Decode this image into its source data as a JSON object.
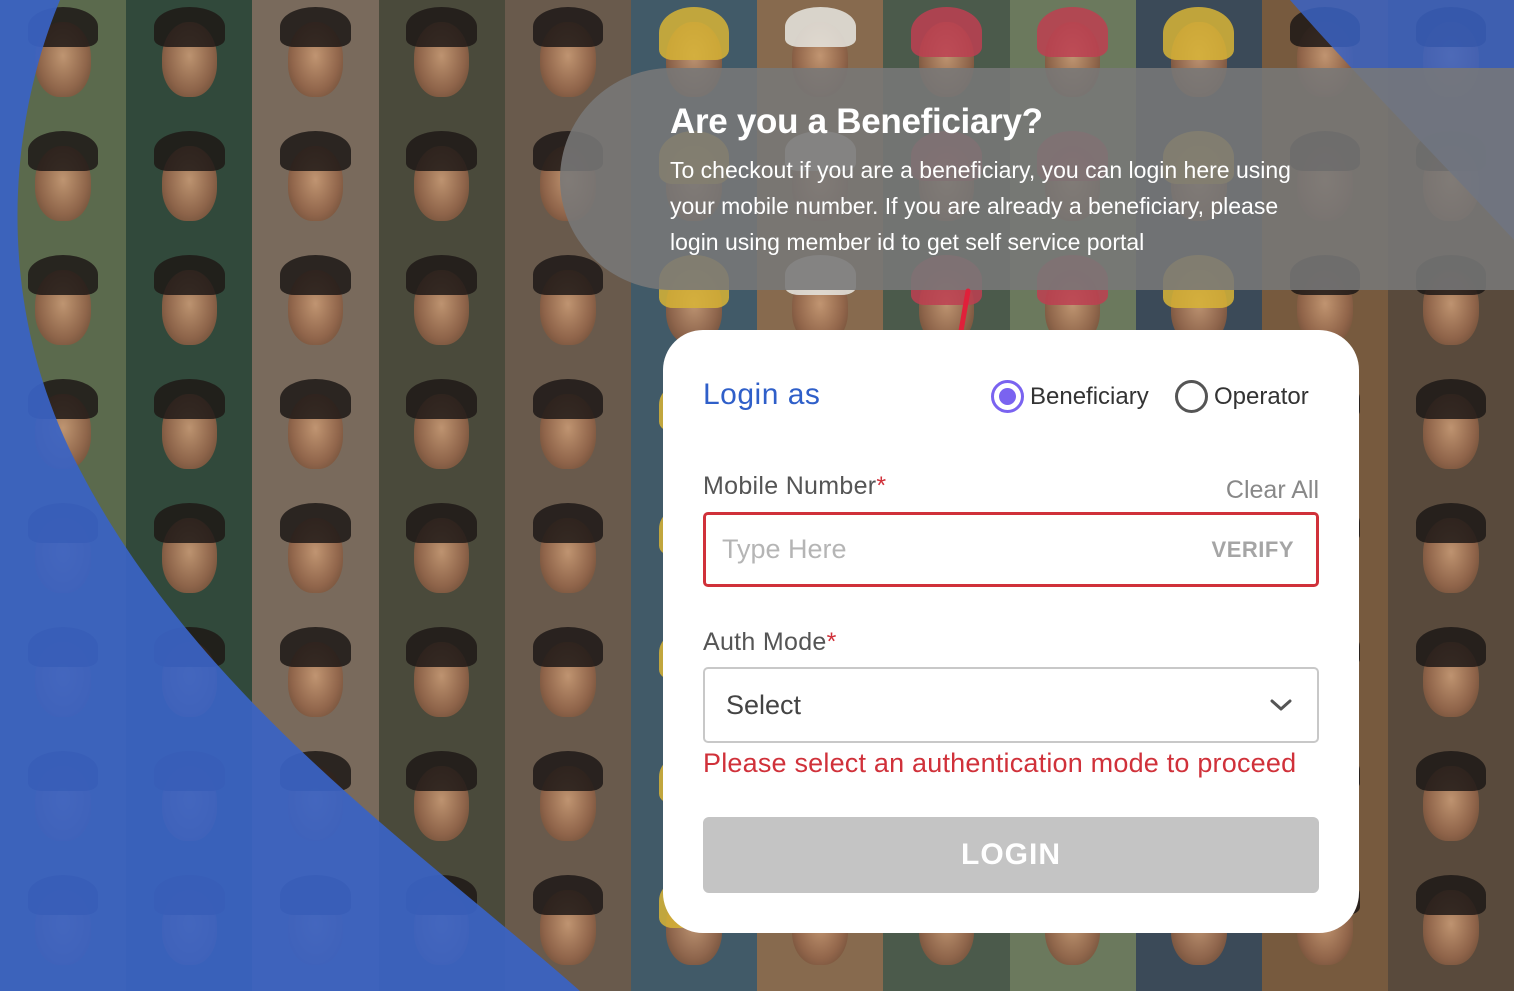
{
  "banner": {
    "title": "Are you a Beneficiary?",
    "text": "To checkout if you are a beneficiary, you can login here using your mobile number. If you are already a beneficiary, please login using member id to get self service portal"
  },
  "login": {
    "heading": "Login as",
    "roles": [
      {
        "label": "Beneficiary",
        "selected": true
      },
      {
        "label": "Operator",
        "selected": false
      }
    ],
    "mobile": {
      "label": "Mobile Number",
      "required_mark": "*",
      "clear_all": "Clear All",
      "placeholder": "Type Here",
      "value": "",
      "verify": "VERIFY"
    },
    "auth_mode": {
      "label": "Auth Mode",
      "required_mark": "*",
      "selected": "Select",
      "error": "Please select an authentication mode to proceed"
    },
    "submit": "LOGIN"
  },
  "colors": {
    "accent_blue": "#2f5fc9",
    "radio_purple": "#7a63f0",
    "error_red": "#d0313a",
    "disabled_button": "#c4c4c4",
    "banner_grey": "#787878",
    "sweep_blue": "#3a63c4"
  }
}
